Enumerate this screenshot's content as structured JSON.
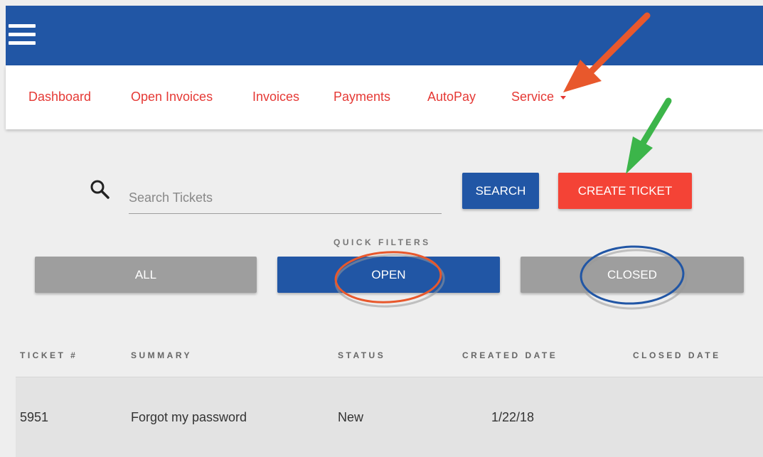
{
  "nav": {
    "items": [
      {
        "label": "Dashboard"
      },
      {
        "label": "Open Invoices"
      },
      {
        "label": "Invoices"
      },
      {
        "label": "Payments"
      },
      {
        "label": "AutoPay"
      },
      {
        "label": "Service"
      }
    ],
    "link_color": "#e53935"
  },
  "topbar": {
    "color": "#2156a5",
    "menu_icon": "hamburger-icon"
  },
  "search": {
    "placeholder": "Search Tickets",
    "value": "",
    "icon": "search-icon",
    "button_label": "SEARCH"
  },
  "create_button": {
    "label": "CREATE TICKET",
    "color": "#f44336"
  },
  "quick_filters": {
    "label": "QUICK FILTERS",
    "options": [
      {
        "label": "ALL",
        "active": false
      },
      {
        "label": "OPEN",
        "active": true
      },
      {
        "label": "CLOSED",
        "active": false
      }
    ]
  },
  "table": {
    "columns": [
      "TICKET #",
      "SUMMARY",
      "STATUS",
      "CREATED DATE",
      "CLOSED DATE"
    ],
    "rows": [
      {
        "ticket": "5951",
        "summary": "Forgot my password",
        "status": "New",
        "created": "1/22/18",
        "closed": ""
      }
    ]
  },
  "annotations": {
    "arrow_colors": [
      "#e8582c",
      "#3cb54a"
    ],
    "circle_colors": [
      "#e8582c",
      "#2156a5"
    ]
  }
}
